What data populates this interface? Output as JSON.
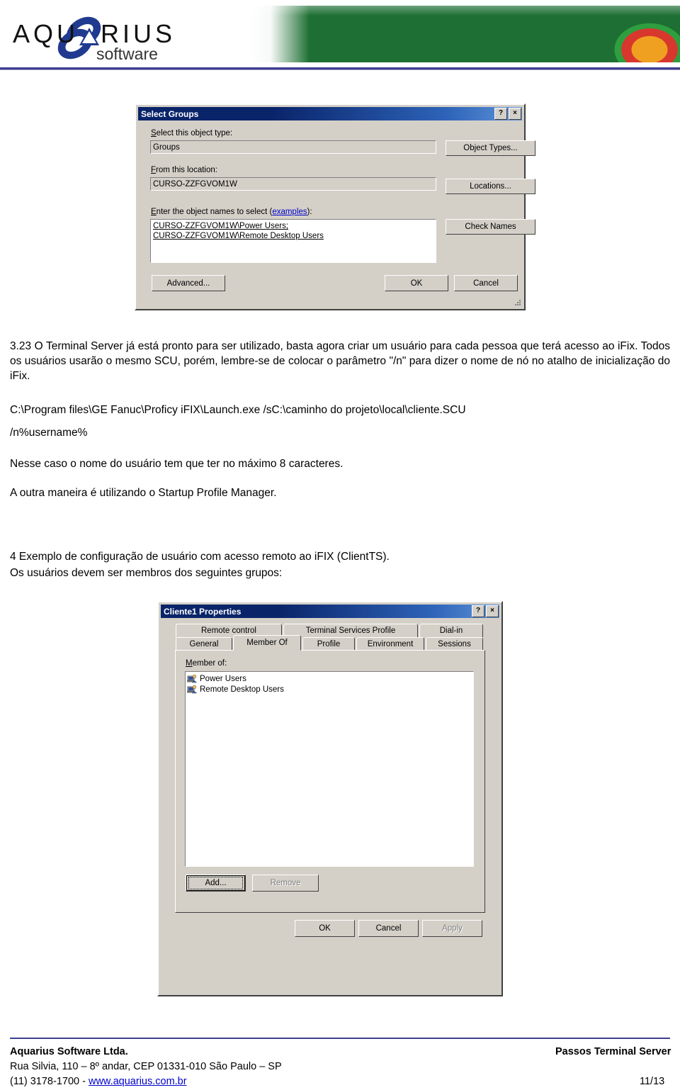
{
  "header": {
    "logo_text_main": "AQUARIUS",
    "logo_text_sub": "software",
    "banner_name": "abstract-paint-banner"
  },
  "select_groups_dialog": {
    "title": "Select Groups",
    "help_button": "?",
    "close_button": "×",
    "object_type_label": "Select this object type:",
    "object_type_value": "Groups",
    "object_types_button": "Object Types...",
    "location_label": "From this location:",
    "location_value": "CURSO-ZZFGVOM1W",
    "locations_button": "Locations...",
    "names_label_pre": "Enter the object names to select (",
    "names_label_link": "examples",
    "names_label_post": "):",
    "names_value_line1": "CURSO-ZZFGVOM1W\\Power Users;",
    "names_value_line2": "CURSO-ZZFGVOM1W\\Remote Desktop Users",
    "check_names_button": "Check Names",
    "advanced_button": "Advanced...",
    "ok_button": "OK",
    "cancel_button": "Cancel"
  },
  "body": {
    "para1": "3.23 O Terminal Server já está pronto para ser utilizado, basta agora criar um usuário para cada pessoa que terá acesso ao iFix. Todos os usuários usarão o mesmo SCU, porém, lembre-se de colocar o parâmetro \"/n\" para dizer o nome de nó no atalho de inicialização do iFix.",
    "cmd_line1": "C:\\Program files\\GE Fanuc\\Proficy iFIX\\Launch.exe /sC:\\caminho do projeto\\local\\cliente.SCU",
    "cmd_line2": "/n%username%",
    "para2": "Nesse caso o nome do usuário tem que ter no máximo 8 caracteres.",
    "para3": "A outra maneira é utilizando o Startup Profile Manager.",
    "para4": "4  Exemplo de configuração de usuário com acesso remoto ao iFIX (ClientTS).",
    "para5": "Os usuários devem ser membros dos seguintes grupos:"
  },
  "cliente_properties_dialog": {
    "title": "Cliente1 Properties",
    "help_button": "?",
    "close_button": "×",
    "tabs_row1": [
      {
        "label": "Remote control",
        "active": false
      },
      {
        "label": "Terminal Services Profile",
        "active": false
      },
      {
        "label": "Dial-in",
        "active": false
      }
    ],
    "tabs_row2": [
      {
        "label": "General",
        "active": false
      },
      {
        "label": "Member Of",
        "active": true
      },
      {
        "label": "Profile",
        "active": false
      },
      {
        "label": "Environment",
        "active": false
      },
      {
        "label": "Sessions",
        "active": false
      }
    ],
    "member_of_label": "Member of:",
    "members": [
      {
        "name": "Power Users",
        "icon": "group-icon"
      },
      {
        "name": "Remote Desktop Users",
        "icon": "group-icon"
      }
    ],
    "add_button": "Add...",
    "remove_button": "Remove",
    "ok_button": "OK",
    "cancel_button": "Cancel",
    "apply_button": "Apply"
  },
  "footer": {
    "company": "Aquarius Software Ltda.",
    "address": "Rua Silvia, 110 – 8º andar, CEP 01331-010 São Paulo – SP",
    "phone_prefix": "(11) 3178-1700 - ",
    "site": "www.aquarius.com.br",
    "doc_title": "Passos Terminal Server",
    "page": "11/13"
  },
  "colors": {
    "accent_blue": "#3f3f8f",
    "title_blue": "#0a246a",
    "dialog_face": "#d4d0c8",
    "link": "#0000cc"
  }
}
